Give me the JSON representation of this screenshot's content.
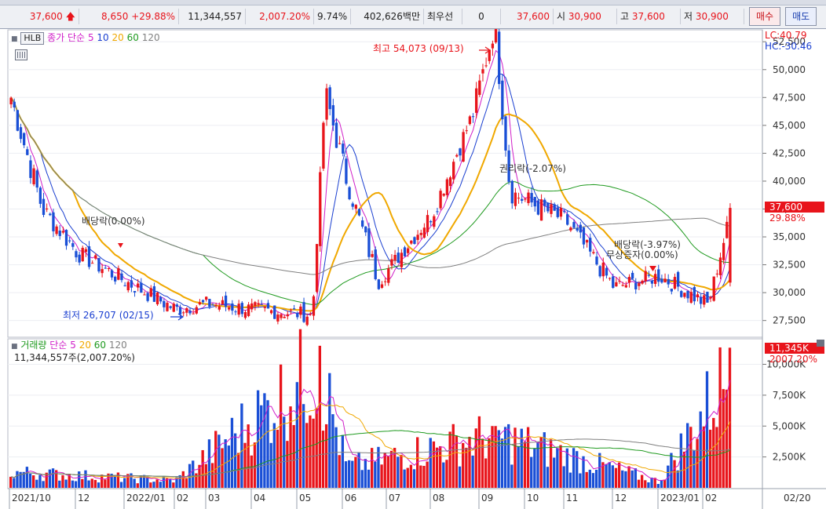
{
  "header": {
    "price": "37,600",
    "change": "8,650",
    "change_pct": "+29.88%",
    "volume": "11,344,557",
    "volume_ratio": "2,007.20%",
    "turnover": "9.74%",
    "amount": "402,626백만",
    "priority_label": "최우선",
    "priority_value": "0",
    "ask": "37,600",
    "open_label": "시",
    "open": "30,900",
    "high_label": "고",
    "high": "37,600",
    "low_label": "저",
    "low": "30,900",
    "buy_button": "매수",
    "sell_button": "매도"
  },
  "price_legend": {
    "symbol": "HLB",
    "series_label": "종가 단순",
    "ma5": "5",
    "ma10": "10",
    "ma20": "20",
    "ma60": "60",
    "ma120": "120"
  },
  "volume_legend": {
    "label": "거래량",
    "series_label": "단순",
    "ma5": "5",
    "ma20": "20",
    "ma60": "60",
    "ma120": "120",
    "current": "11,344,557주(2,007.20%)"
  },
  "right_axis": {
    "lc": "LC:40.79",
    "hc": "HC:-30.46",
    "price_tag": "37,600",
    "price_pct": "29.88%",
    "volume_tag": "11,345K",
    "volume_pct": "2007.20%",
    "date_label": "02/20"
  },
  "annotations": {
    "high": "최고 54,073 (09/13)",
    "low": "최저 26,707 (02/15)",
    "dividend1": "배당락(0.00%)",
    "rights": "권리락(-2.07%)",
    "dividend2": "배당락(-3.97%)",
    "bonus": "무상증자(0.00%)"
  },
  "colors": {
    "up": "#e8141b",
    "down": "#1a4fd6",
    "ma5": "#d01ec8",
    "ma10": "#1a3fd0",
    "ma20": "#f0a800",
    "ma60": "#1f9a1f",
    "ma120": "#808080"
  },
  "chart_data": {
    "type": "candlestick",
    "price_axis": {
      "min": 26000,
      "max": 53500,
      "ticks": [
        "52,500",
        "50,000",
        "47,500",
        "45,000",
        "42,500",
        "40,000",
        "37,500",
        "35,000",
        "32,500",
        "30,000",
        "27,500"
      ]
    },
    "volume_axis": {
      "min": 0,
      "max": 12000,
      "ticks": [
        "10,000K",
        "7,500K",
        "5,000K",
        "2,500K"
      ],
      "unit": "K"
    },
    "x_ticks": [
      "2021/10",
      "12",
      "2022/01",
      "02",
      "03",
      "04",
      "05",
      "06",
      "07",
      "08",
      "09",
      "10",
      "11",
      "12",
      "2023/01",
      "02"
    ],
    "close_anchors": [
      [
        "2021/10",
        47500
      ],
      [
        "2021/11",
        37500
      ],
      [
        "2021/12",
        33500
      ],
      [
        "2022/01",
        31000
      ],
      [
        "2022/02",
        28500
      ],
      [
        "2022/03",
        29000
      ],
      [
        "2022/04",
        28500
      ],
      [
        "2022/05 start",
        28000
      ],
      [
        "2022/05 peak",
        48000
      ],
      [
        "2022/06",
        40000
      ],
      [
        "2022/07",
        31000
      ],
      [
        "2022/08",
        37000
      ],
      [
        "2022/09",
        46000
      ],
      [
        "2022/09/13",
        54073
      ],
      [
        "2022/10",
        39000
      ],
      [
        "2022/11",
        36500
      ],
      [
        "2022/12",
        30500
      ],
      [
        "2023/01",
        31500
      ],
      [
        "2023/02",
        28900
      ],
      [
        "2023/02/20",
        37600
      ]
    ],
    "volume_anchors_k": [
      [
        "2021/10",
        1500
      ],
      [
        "2022/02",
        700
      ],
      [
        "2022/05 peak",
        11500
      ],
      [
        "2022/06",
        2000
      ],
      [
        "2022/09",
        5000
      ],
      [
        "2023/01",
        600
      ],
      [
        "2023/02/20",
        11345
      ]
    ]
  }
}
